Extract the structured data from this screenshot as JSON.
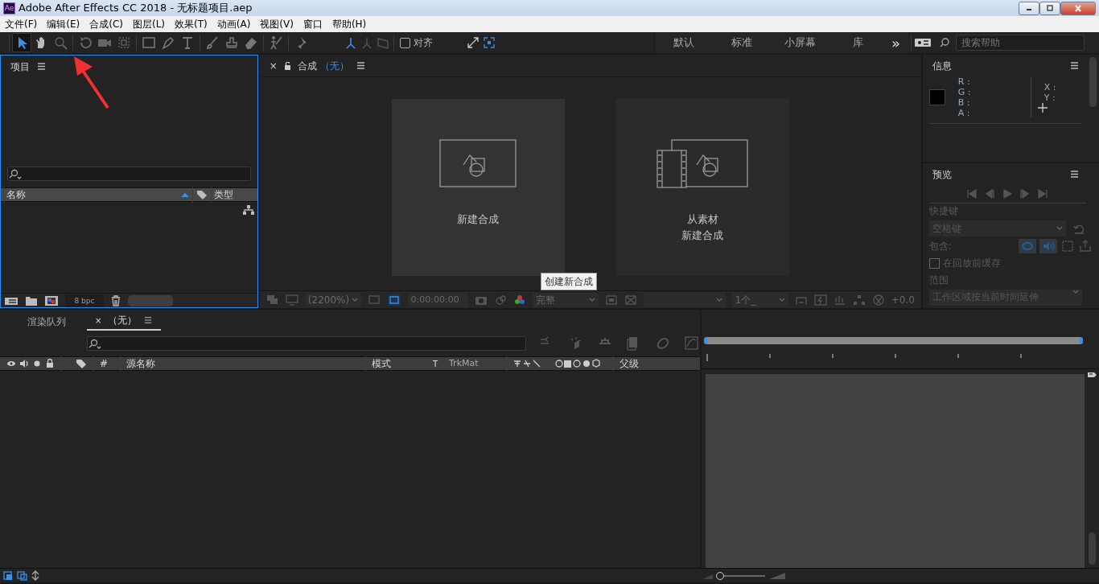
{
  "window": {
    "app_badge": "Ae",
    "title": "Adobe After Effects CC 2018 - 无标题项目.aep"
  },
  "menu": [
    "文件(F)",
    "编辑(E)",
    "合成(C)",
    "图层(L)",
    "效果(T)",
    "动画(A)",
    "视图(V)",
    "窗口",
    "帮助(H)"
  ],
  "toolbar": {
    "tools": [
      {
        "kind": "select",
        "selected": true
      },
      {
        "kind": "hand",
        "selected": false
      },
      {
        "kind": "zoom",
        "selected": false
      },
      {
        "kind": "rotate",
        "selected": false
      },
      {
        "kind": "camera",
        "selected": false
      },
      {
        "kind": "pan",
        "selected": false
      },
      {
        "kind": "rect",
        "selected": false
      },
      {
        "kind": "pen",
        "selected": false
      },
      {
        "kind": "text",
        "selected": false
      },
      {
        "kind": "brush",
        "selected": false
      },
      {
        "kind": "stamp",
        "selected": false
      },
      {
        "kind": "eraser",
        "selected": false
      },
      {
        "kind": "roto",
        "selected": false
      },
      {
        "kind": "pin",
        "selected": false
      }
    ],
    "snap": {
      "label": "对齐",
      "checked": false
    },
    "workspaces": [
      "默认",
      "标准",
      "小屏幕",
      "库"
    ],
    "more": "»",
    "search_help": {
      "placeholder": "搜索帮助"
    }
  },
  "project_panel": {
    "title": "项目",
    "columns": [
      "名称",
      "类型"
    ],
    "bpc": "8 bpc"
  },
  "composition_panel": {
    "close": "×",
    "tab": "合成",
    "name": "（无）",
    "cards": [
      {
        "kind": "new",
        "lines": [
          "新建合成"
        ]
      },
      {
        "kind": "footage",
        "lines": [
          "从素材",
          "新建合成"
        ]
      }
    ],
    "tooltip": "创建新合成",
    "zoom": "(2200%)",
    "timecode": "0:00:00:00",
    "resolution": "完整",
    "views": "1个_",
    "exposure": "+0.0"
  },
  "info_panel": {
    "title": "信息",
    "channels": [
      "R :",
      "G :",
      "B :",
      "A :"
    ],
    "coords": [
      "X :",
      "Y :"
    ]
  },
  "preview_panel": {
    "title": "预览",
    "shortcut_label": "快捷键",
    "shortcut": "空格键",
    "include_label": "包含:",
    "cache": {
      "label": "在回放前缓存",
      "checked": false
    },
    "range_label": "范围",
    "range": "工作区域按当前时间延伸"
  },
  "timeline": {
    "tabs": [
      {
        "label": "渲染队列",
        "selected": false
      },
      {
        "label": "（无）",
        "selected": true,
        "close": "×"
      }
    ],
    "columns": [
      "#",
      "源名称",
      "模式",
      "T",
      "TrkMat",
      "父级"
    ],
    "zoom_slider": {
      "level": 0.07
    }
  }
}
